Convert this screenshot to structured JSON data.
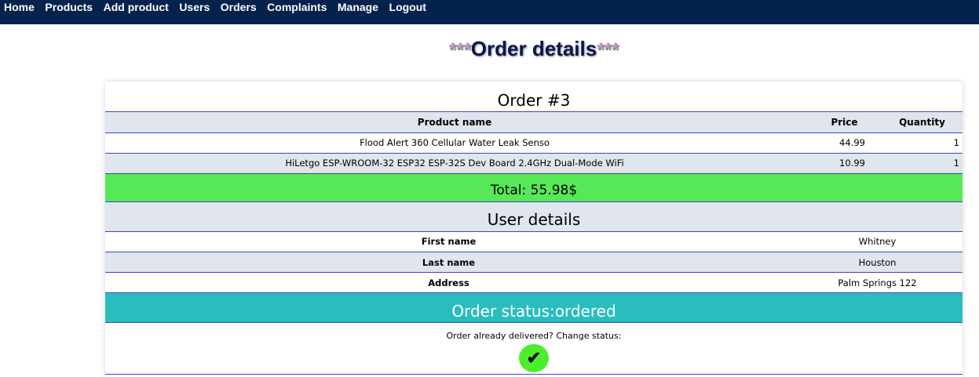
{
  "nav": {
    "items": [
      "Home",
      "Products",
      "Add product",
      "Users",
      "Orders",
      "Complaints",
      "Manage",
      "Logout"
    ]
  },
  "heading": {
    "prefix": "***",
    "title": "Order details",
    "suffix": "***"
  },
  "order": {
    "title": "Order #3",
    "columns": {
      "name": "Product name",
      "price": "Price",
      "quantity": "Quantity"
    },
    "products": [
      {
        "name": "Flood Alert 360 Cellular Water Leak Senso",
        "price": "44.99",
        "quantity": "1"
      },
      {
        "name": "HiLetgo ESP-WROOM-32 ESP32 ESP-32S Dev Board 2.4GHz Dual-Mode WiFi",
        "price": "10.99",
        "quantity": "1"
      }
    ],
    "total": "Total: 55.98$"
  },
  "user": {
    "title": "User details",
    "rows": [
      {
        "label": "First name",
        "value": "Whitney"
      },
      {
        "label": "Last name",
        "value": "Houston"
      },
      {
        "label": "Address",
        "value": "Palm Springs 122"
      }
    ]
  },
  "status": {
    "text": "Order status:ordered",
    "change_label": "Order already delivered? Change status:",
    "button_icon": "check-icon",
    "button_symbol": "✔"
  },
  "colors": {
    "navbar": "#03224c",
    "total": "#57e857",
    "status": "#2bbdbd",
    "button": "#4cee2c"
  }
}
